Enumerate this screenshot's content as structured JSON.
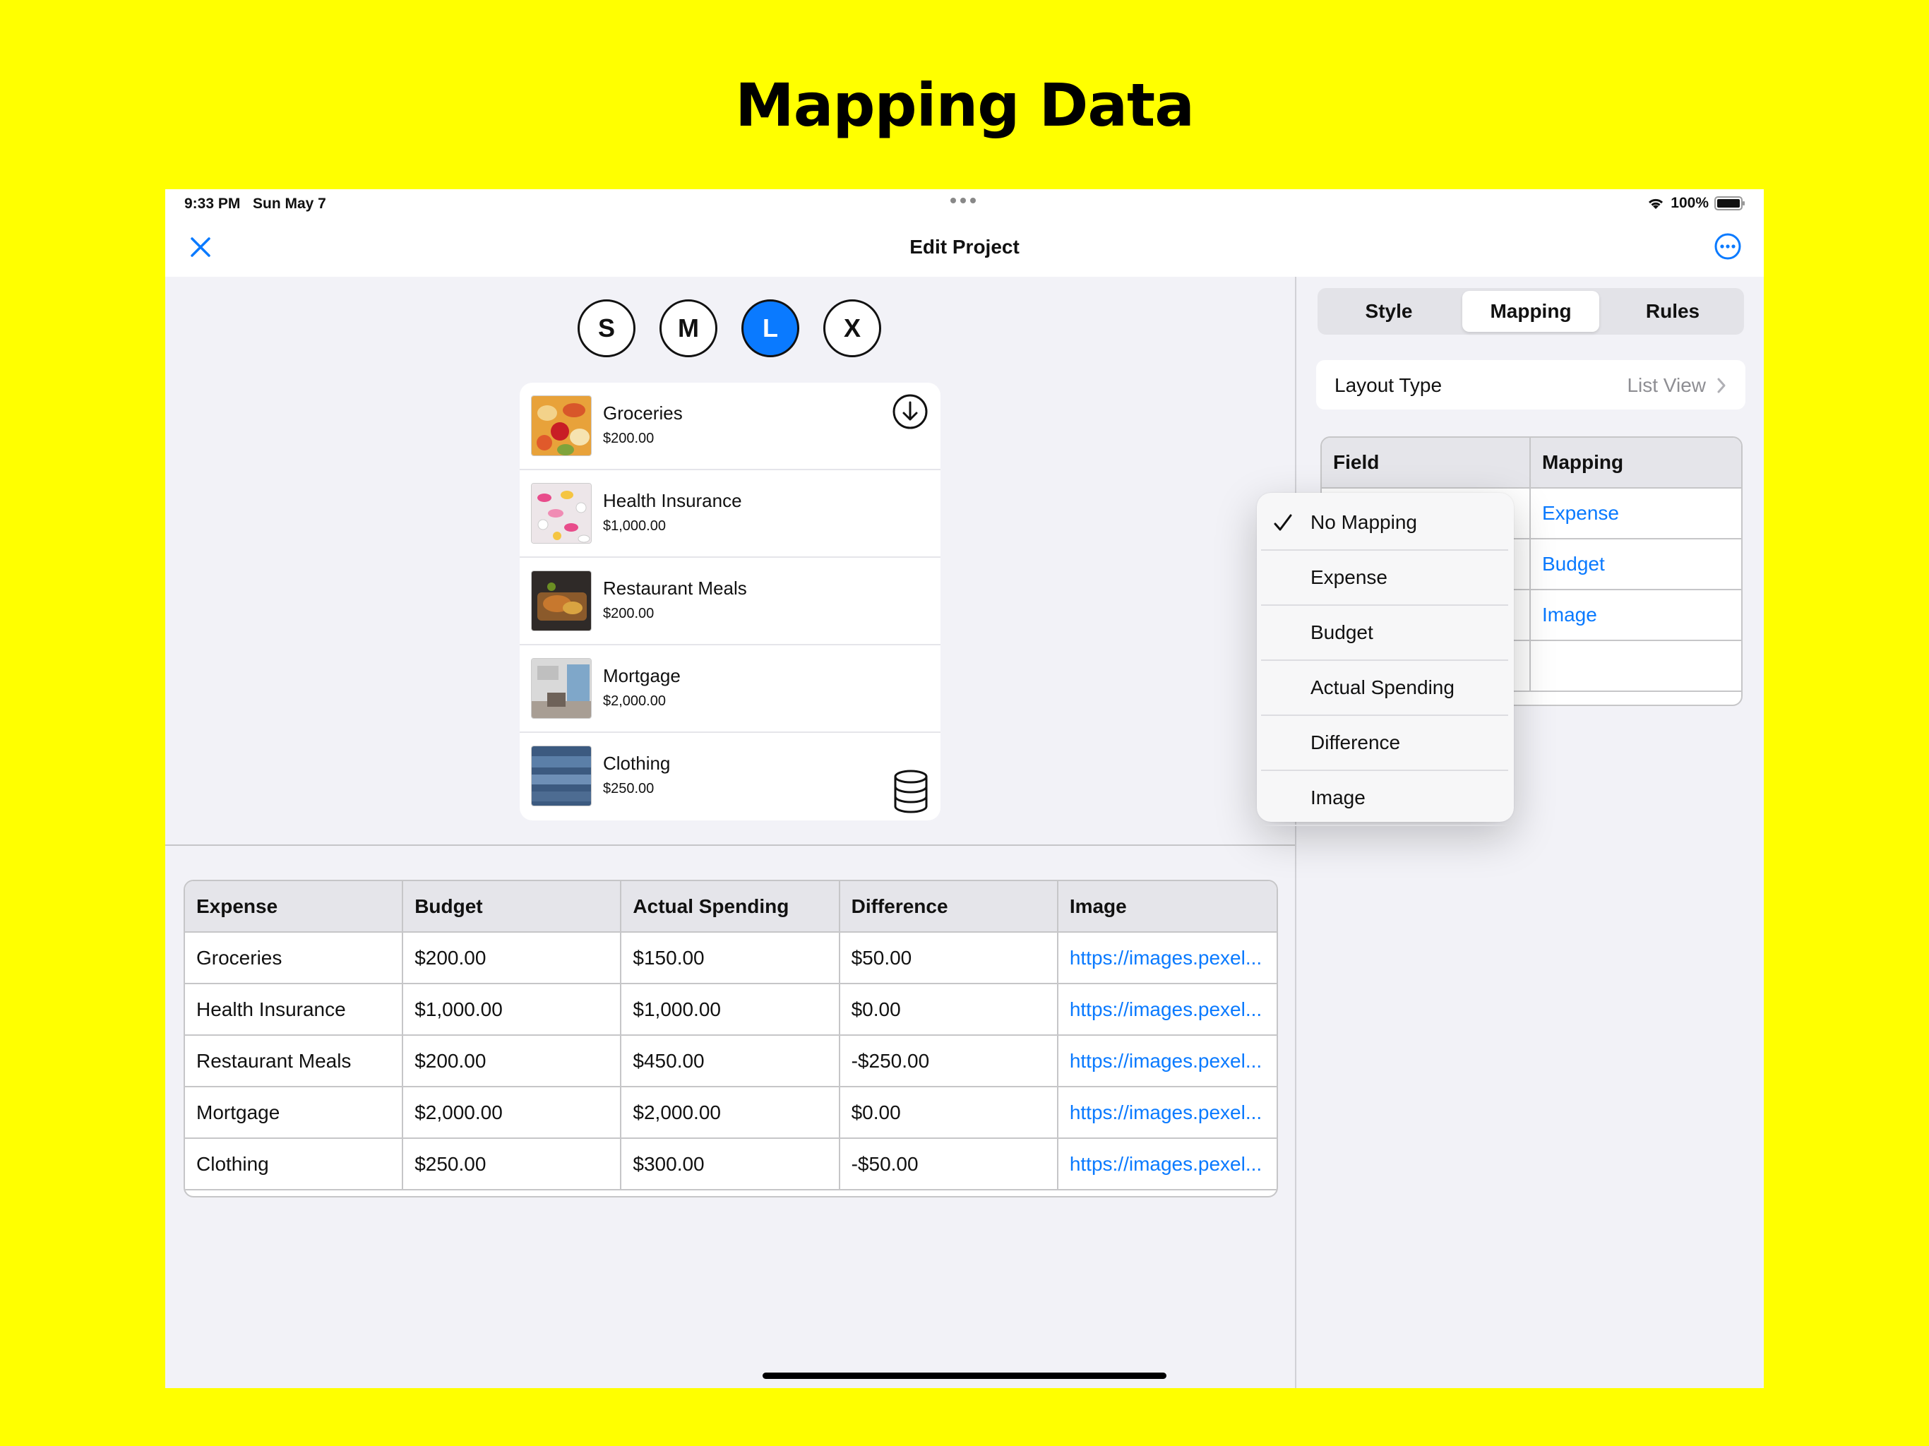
{
  "headline": "Mapping Data",
  "status_bar": {
    "time": "9:33 PM",
    "date": "Sun May 7",
    "battery": "100%"
  },
  "nav": {
    "title": "Edit Project"
  },
  "size_buttons": [
    {
      "label": "S",
      "selected": false
    },
    {
      "label": "M",
      "selected": false
    },
    {
      "label": "L",
      "selected": true
    },
    {
      "label": "X",
      "selected": false
    }
  ],
  "preview_list": [
    {
      "title": "Groceries",
      "amount": "$200.00",
      "thumb": "groceries"
    },
    {
      "title": "Health Insurance",
      "amount": "$1,000.00",
      "thumb": "pills"
    },
    {
      "title": "Restaurant Meals",
      "amount": "$200.00",
      "thumb": "food"
    },
    {
      "title": "Mortgage",
      "amount": "$2,000.00",
      "thumb": "room"
    },
    {
      "title": "Clothing",
      "amount": "$250.00",
      "thumb": "denim"
    }
  ],
  "data_table": {
    "headers": [
      "Expense",
      "Budget",
      "Actual Spending",
      "Difference",
      "Image"
    ],
    "rows": [
      [
        "Groceries",
        "$200.00",
        "$150.00",
        "$50.00",
        "https://images.pexel..."
      ],
      [
        "Health Insurance",
        "$1,000.00",
        "$1,000.00",
        "$0.00",
        "https://images.pexel..."
      ],
      [
        "Restaurant Meals",
        "$200.00",
        "$450.00",
        "-$250.00",
        "https://images.pexel..."
      ],
      [
        "Mortgage",
        "$2,000.00",
        "$2,000.00",
        "$0.00",
        "https://images.pexel..."
      ],
      [
        "Clothing",
        "$250.00",
        "$300.00",
        "-$50.00",
        "https://images.pexel..."
      ]
    ]
  },
  "inspector": {
    "tabs": [
      {
        "label": "Style",
        "selected": false
      },
      {
        "label": "Mapping",
        "selected": true
      },
      {
        "label": "Rules",
        "selected": false
      }
    ],
    "layout_type": {
      "label": "Layout Type",
      "value": "List View"
    },
    "mapping_table": {
      "headers": [
        "Field",
        "Mapping"
      ],
      "rows": [
        {
          "field": "",
          "mapping": "Expense"
        },
        {
          "field": "",
          "mapping": "Budget"
        },
        {
          "field": "",
          "mapping": "Image"
        },
        {
          "field": "",
          "mapping": ""
        }
      ]
    }
  },
  "dropdown": {
    "items": [
      {
        "label": "No Mapping",
        "checked": true
      },
      {
        "label": "Expense",
        "checked": false
      },
      {
        "label": "Budget",
        "checked": false
      },
      {
        "label": "Actual Spending",
        "checked": false
      },
      {
        "label": "Difference",
        "checked": false
      },
      {
        "label": "Image",
        "checked": false
      }
    ]
  },
  "colors": {
    "accent": "#0A7AFF",
    "background": "#FFFF00",
    "surface": "#F2F2F7"
  }
}
